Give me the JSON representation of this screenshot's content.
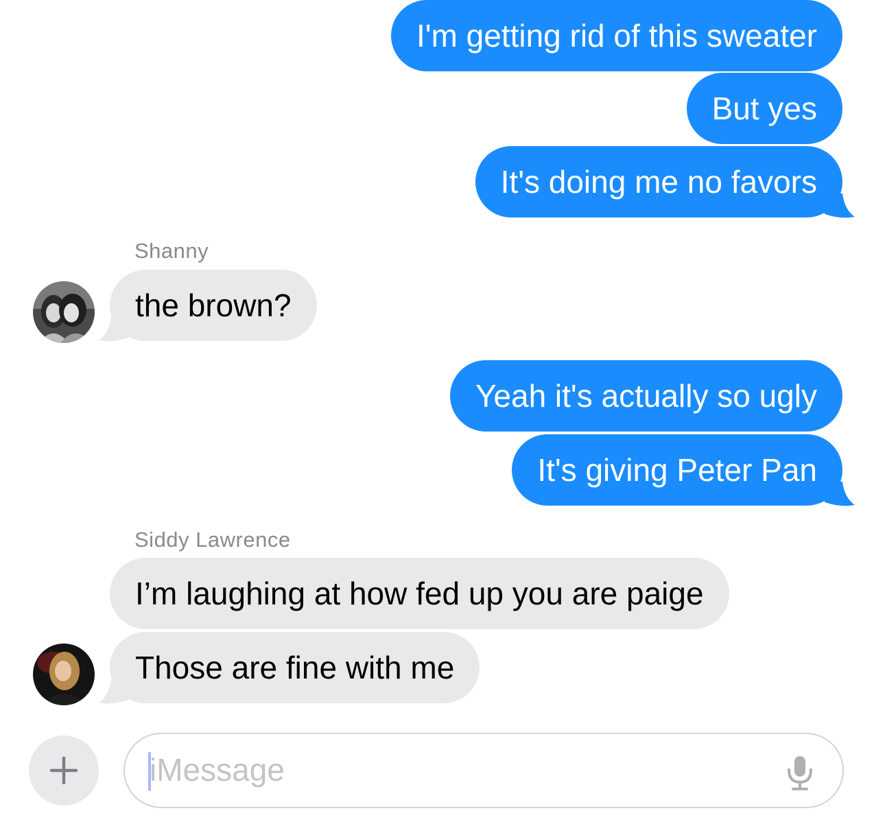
{
  "conversation": {
    "outgoing_group_1": [
      "I'm getting rid of this sweater",
      "But yes",
      "It's doing me no favors"
    ],
    "incoming_1": {
      "sender": "Shanny",
      "messages": [
        "the brown?"
      ]
    },
    "outgoing_group_2": [
      "Yeah it's actually so ugly",
      "It's giving Peter Pan"
    ],
    "incoming_2": {
      "sender": "Siddy Lawrence",
      "messages": [
        "I’m laughing at how fed up you are paige",
        "Those are fine with me"
      ]
    }
  },
  "composer": {
    "placeholder": "iMessage",
    "plus_icon": "plus-icon",
    "mic_icon": "microphone-icon"
  },
  "colors": {
    "outgoing_bubble": "#1a8cfe",
    "incoming_bubble": "#e9e9eb",
    "sender_name": "#8a8a8e"
  }
}
